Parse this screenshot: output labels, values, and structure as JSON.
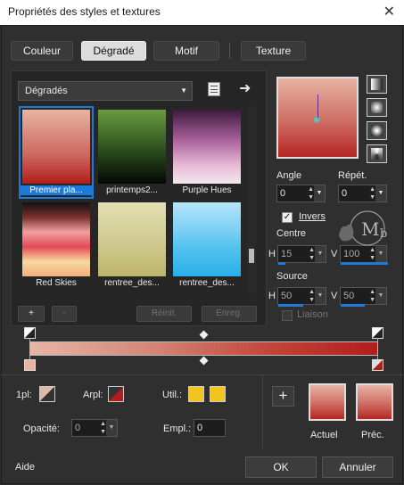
{
  "window": {
    "title": "Propriétés des styles et textures",
    "close": "✕"
  },
  "tabs": [
    {
      "label": "Couleur",
      "active": false
    },
    {
      "label": "Dégradé",
      "active": true
    },
    {
      "label": "Motif",
      "active": false
    },
    {
      "label": "Texture",
      "active": false
    }
  ],
  "gradients": {
    "category": "Dégradés",
    "items": [
      {
        "label": "Premier pla...",
        "selected": true
      },
      {
        "label": "printemps2..."
      },
      {
        "label": "Purple Hues"
      },
      {
        "label": "Red Skies"
      },
      {
        "label": "rentree_des..."
      },
      {
        "label": "rentree_des..."
      }
    ],
    "add": "+",
    "remove": "-",
    "reset": "Réinit.",
    "save": "Enreg."
  },
  "props": {
    "angle_label": "Angle",
    "angle_value": "0",
    "repeat_label": "Répét.",
    "repeat_value": "0",
    "invert_label": "Invers",
    "invert_checked": true,
    "centre_label": "Centre",
    "centre_h_label": "H",
    "centre_h": "15",
    "centre_v_label": "V",
    "centre_v": "100",
    "source_label": "Source",
    "source_h_label": "H",
    "source_h": "50",
    "source_v_label": "V",
    "source_v": "50",
    "link_label": "Liaison",
    "link_checked": false
  },
  "stops": {
    "fg_label": "1pl:",
    "bg_label": "Arpl:",
    "user_label": "Util.:",
    "opacity_label": "Opacité:",
    "opacity_value": "0",
    "location_label": "Empl.:",
    "location_value": "0",
    "user_colors": [
      "#f3c41c",
      "#f3c41c"
    ]
  },
  "compare": {
    "add": "+",
    "current": "Actuel",
    "previous": "Préc."
  },
  "footer": {
    "help": "Aide",
    "ok": "OK",
    "cancel": "Annuler"
  },
  "colors": {
    "accent": "#1e7ad8",
    "gradient_start": "#e8b5a4",
    "gradient_end": "#b21d1b"
  }
}
